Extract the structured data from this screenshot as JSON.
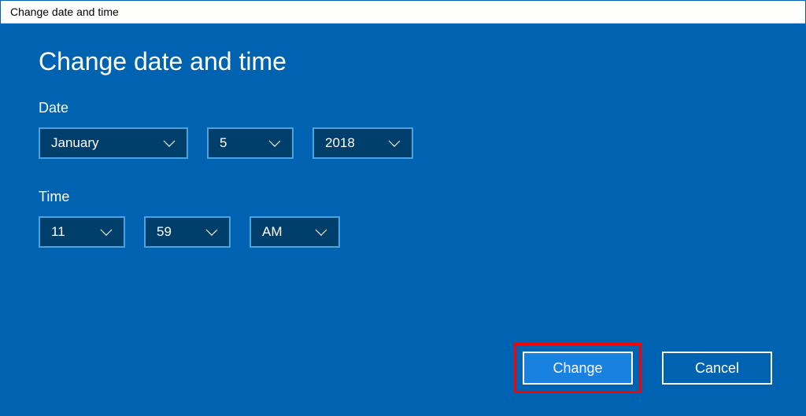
{
  "window": {
    "title": "Change date and time"
  },
  "heading": "Change date and time",
  "date": {
    "label": "Date",
    "month": "January",
    "day": "5",
    "year": "2018"
  },
  "time": {
    "label": "Time",
    "hour": "11",
    "minute": "59",
    "ampm": "AM"
  },
  "buttons": {
    "change": "Change",
    "cancel": "Cancel"
  }
}
